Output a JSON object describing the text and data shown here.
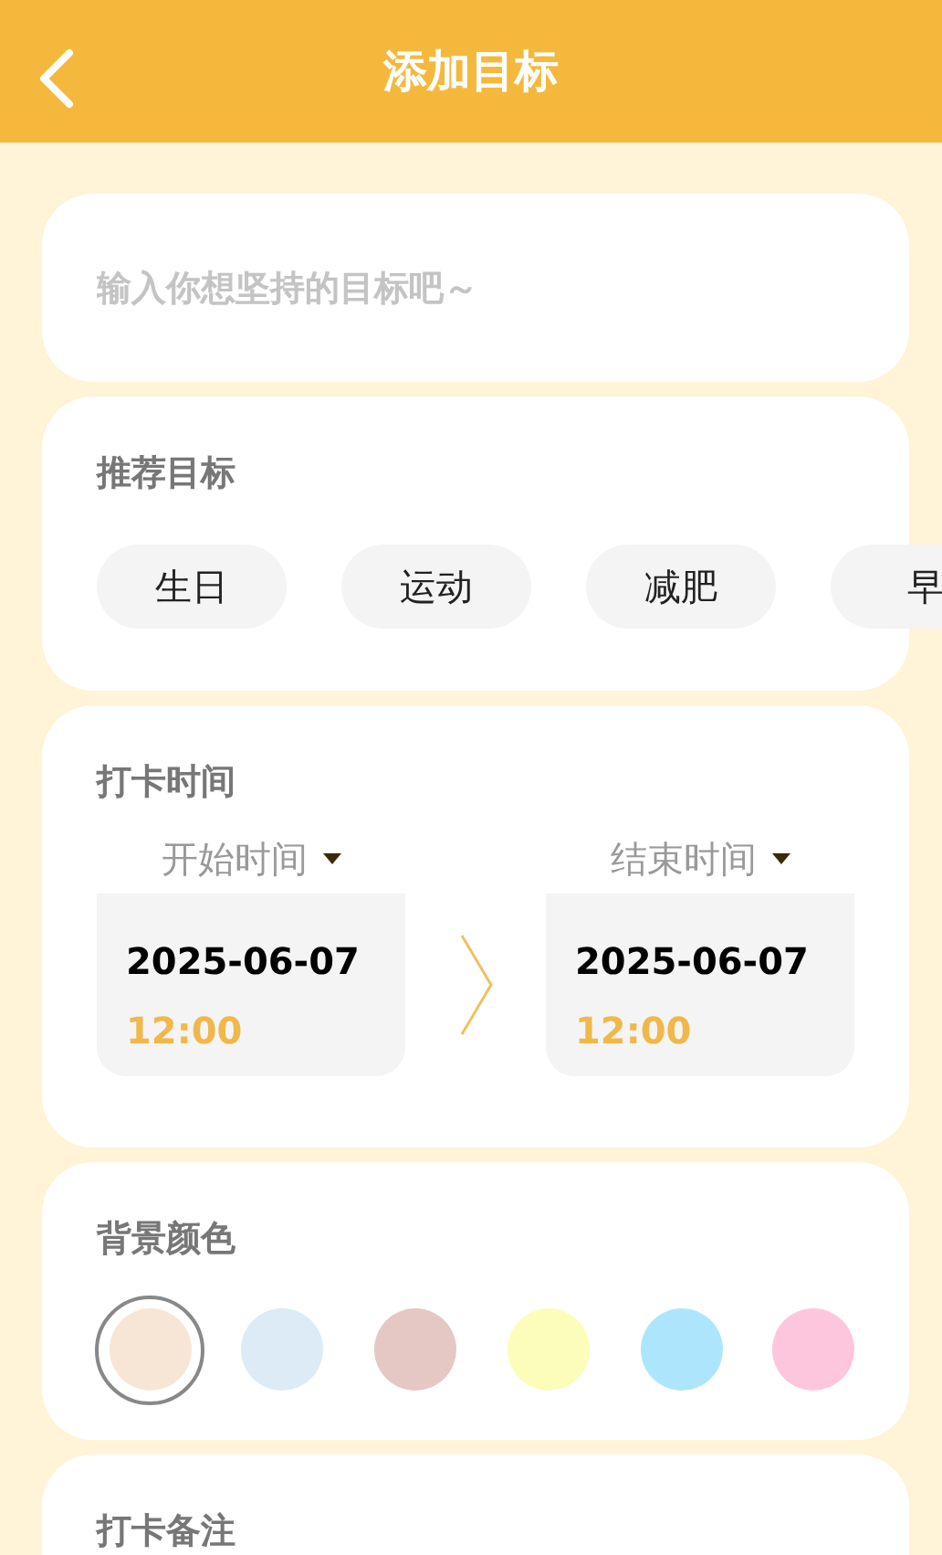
{
  "header": {
    "title": "添加目标"
  },
  "goal_input": {
    "placeholder": "输入你想坚持的目标吧～"
  },
  "recommend": {
    "title": "推荐目标",
    "chips": [
      "生日",
      "运动",
      "减肥",
      "早"
    ]
  },
  "checkin_time": {
    "title": "打卡时间",
    "start": {
      "label": "开始时间",
      "date": "2025-06-07",
      "time": "12:00"
    },
    "end": {
      "label": "结束时间",
      "date": "2025-06-07",
      "time": "12:00"
    }
  },
  "background_color": {
    "title": "背景颜色",
    "swatches": [
      {
        "color": "#f7e6d6",
        "selected": true
      },
      {
        "color": "#dcebf5",
        "selected": false
      },
      {
        "color": "#e5c8c4",
        "selected": false
      },
      {
        "color": "#fdfdbb",
        "selected": false
      },
      {
        "color": "#ade6fc",
        "selected": false
      },
      {
        "color": "#fdc6dd",
        "selected": false
      }
    ]
  },
  "note": {
    "title": "打卡备注"
  }
}
